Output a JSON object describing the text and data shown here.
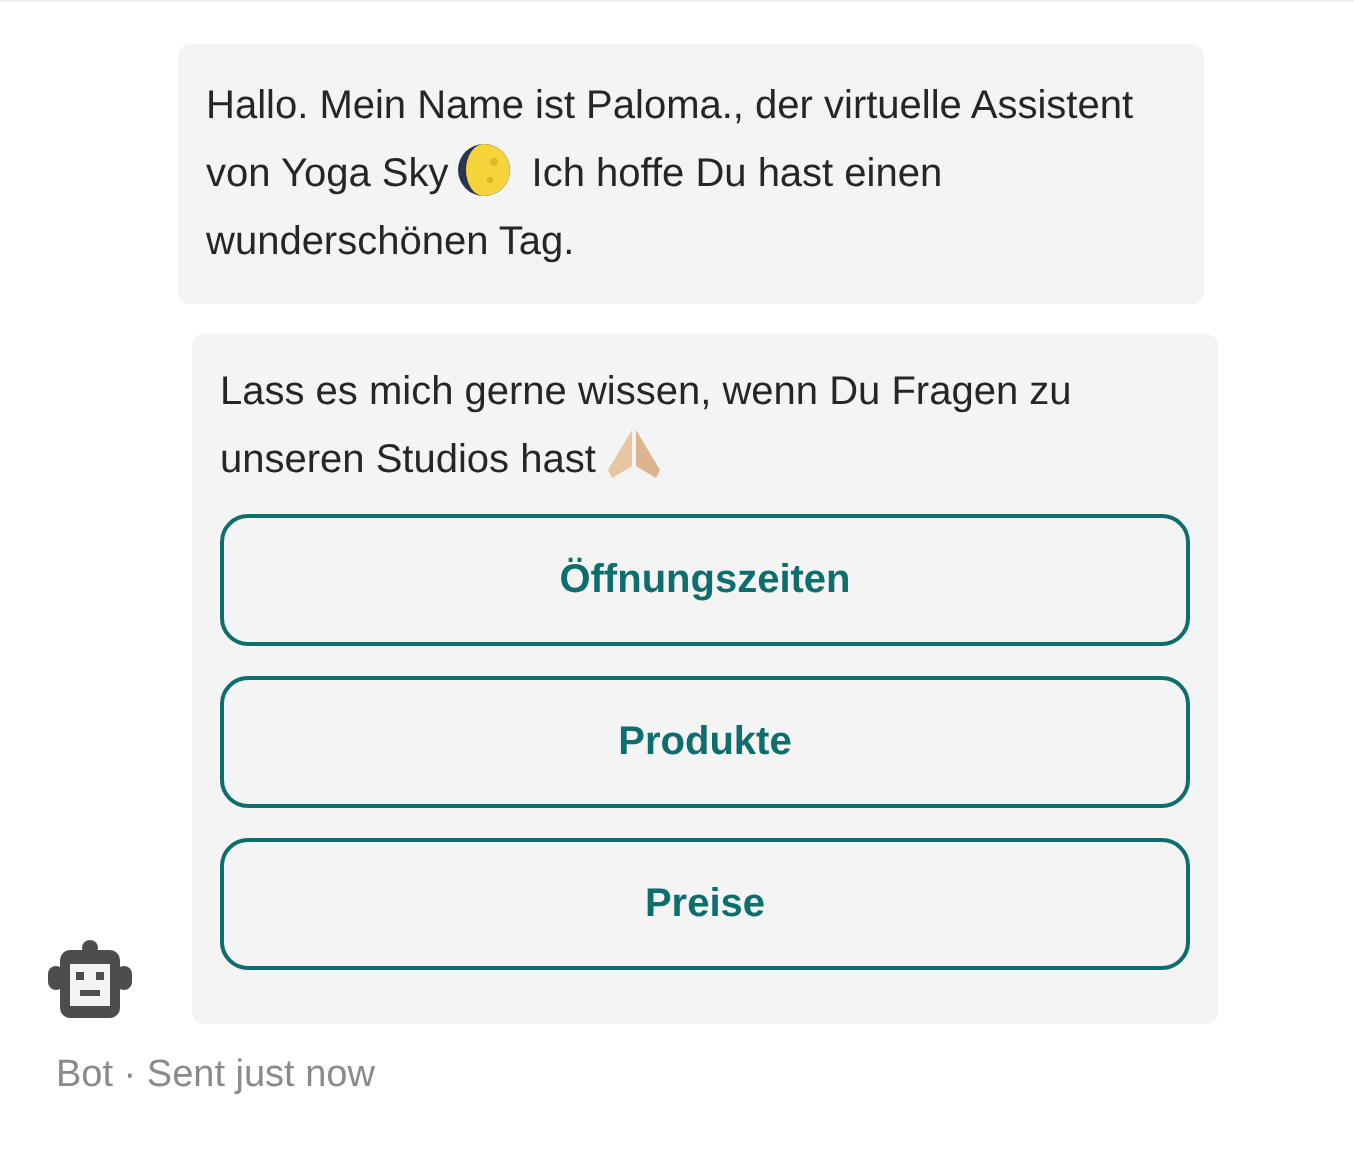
{
  "messages": [
    {
      "text_before": "Hallo. Mein Name ist Paloma., der virtuelle Assistent von Yoga Sky",
      "text_after": "Ich hoffe Du hast einen wunderschönen Tag."
    },
    {
      "text_before": "Lass es mich gerne wissen, wenn Du Fragen zu unseren Studios hast",
      "buttons": [
        "Öffnungszeiten",
        "Produkte",
        "Preise"
      ]
    }
  ],
  "footer": "Bot · Sent just now"
}
